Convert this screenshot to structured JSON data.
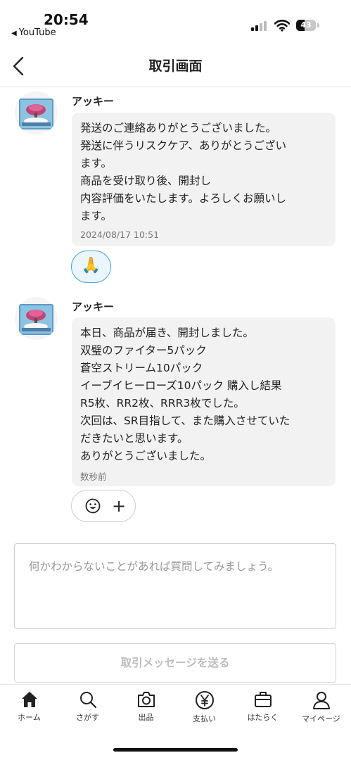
{
  "status_bar": {
    "time": "20:54",
    "back_app": "YouTube",
    "battery": "43",
    "battery_level_percent": 43,
    "icons": [
      "signal-icon",
      "wifi-icon",
      "battery-icon"
    ]
  },
  "header": {
    "title": "取引画面",
    "back_icon": "chevron-left-icon"
  },
  "messages": [
    {
      "sender": "アッキー",
      "lines": [
        "発送のご連絡ありがとうございました。",
        "発送に伴うリスクケア、ありがとうござい",
        "ます。",
        "商品を受け取り後、開封し",
        "内容評価をいたします。よろしくお願いし",
        "ます。"
      ],
      "time": "2024/08/17 10:51",
      "reaction": "🙏"
    },
    {
      "sender": "アッキー",
      "lines": [
        "本日、商品が届き、開封しました。",
        "双璧のファイター5パック",
        "蒼空ストリーム10パック",
        "イーブイヒーローズ10パック  購入し結果",
        "R5枚、RR2枚、RRR3枚でした。",
        "次回は、SR目指して、また購入させていた",
        "だきたいと思います。",
        "ありがとうございました。"
      ],
      "time": "数秒前",
      "reaction_add": {
        "smile_icon": "smile-icon",
        "plus": "+"
      }
    }
  ],
  "composer": {
    "placeholder": "何かわからないことがあれば質問してみましょう。",
    "send_label": "取引メッセージを送る"
  },
  "tabs": [
    {
      "label": "ホーム",
      "icon": "home-icon"
    },
    {
      "label": "さがす",
      "icon": "search-icon"
    },
    {
      "label": "出品",
      "icon": "camera-icon"
    },
    {
      "label": "支払い",
      "icon": "yen-icon"
    },
    {
      "label": "はたらく",
      "icon": "briefcase-icon"
    },
    {
      "label": "マイページ",
      "icon": "person-icon"
    }
  ],
  "colors": {
    "reaction_border": "#47a8e4",
    "bubble_bg": "#f2f2f2"
  }
}
